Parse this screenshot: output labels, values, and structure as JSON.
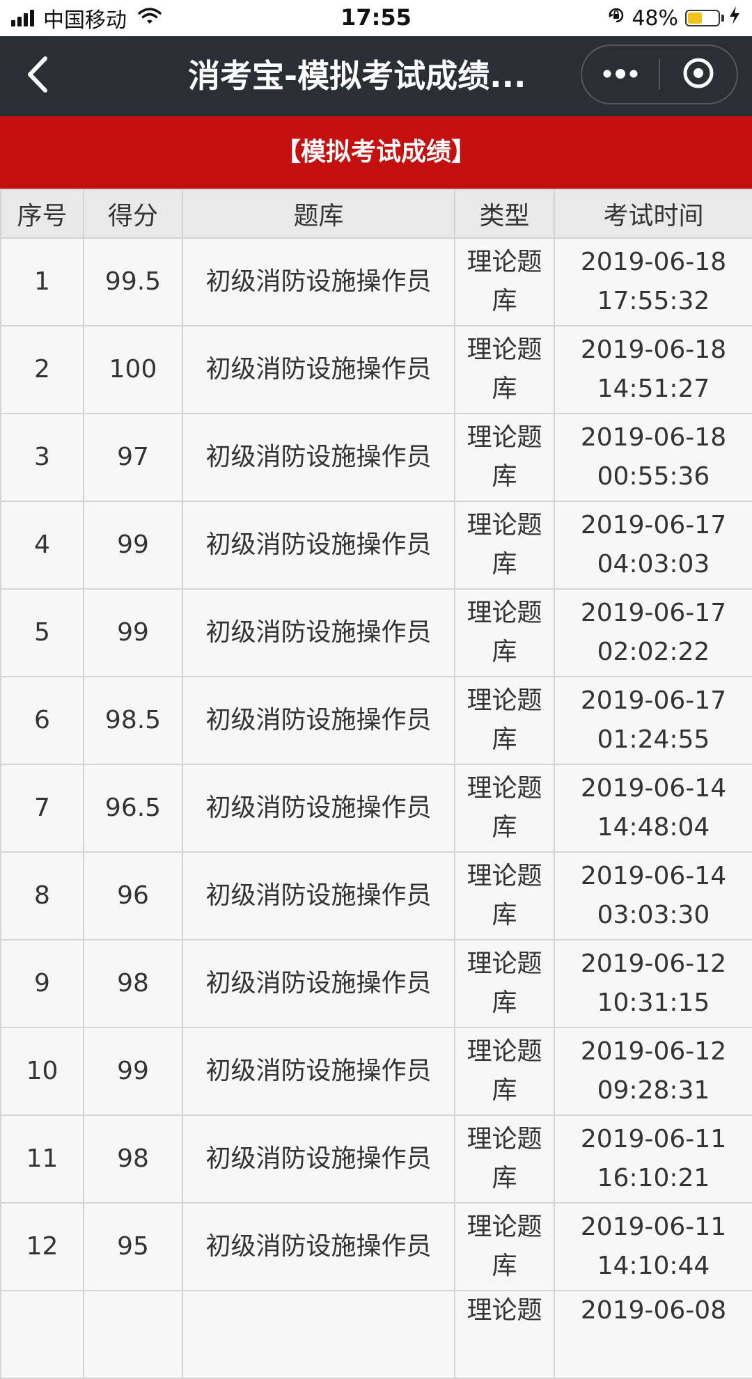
{
  "status_bar": {
    "carrier": "中国移动",
    "time": "17:55",
    "battery_percent": "48%",
    "battery_level": 0.48,
    "battery_color": "#f2c318"
  },
  "nav": {
    "title": "消考宝-模拟考试成绩...",
    "back_icon": "chevron-left-icon",
    "more_icon": "more-dots-icon",
    "close_icon": "target-circle-icon",
    "background": "#2b2f33"
  },
  "banner": {
    "text": "【模拟考试成绩】",
    "background": "#c4110f"
  },
  "table": {
    "headers": [
      "序号",
      "得分",
      "题库",
      "类型",
      "考试时间"
    ],
    "rows": [
      {
        "no": "1",
        "score": "99.5",
        "bank": "初级消防设施操作员",
        "type": "理论题库",
        "date": "2019-06-18",
        "time": "17:55:32"
      },
      {
        "no": "2",
        "score": "100",
        "bank": "初级消防设施操作员",
        "type": "理论题库",
        "date": "2019-06-18",
        "time": "14:51:27"
      },
      {
        "no": "3",
        "score": "97",
        "bank": "初级消防设施操作员",
        "type": "理论题库",
        "date": "2019-06-18",
        "time": "00:55:36"
      },
      {
        "no": "4",
        "score": "99",
        "bank": "初级消防设施操作员",
        "type": "理论题库",
        "date": "2019-06-17",
        "time": "04:03:03"
      },
      {
        "no": "5",
        "score": "99",
        "bank": "初级消防设施操作员",
        "type": "理论题库",
        "date": "2019-06-17",
        "time": "02:02:22"
      },
      {
        "no": "6",
        "score": "98.5",
        "bank": "初级消防设施操作员",
        "type": "理论题库",
        "date": "2019-06-17",
        "time": "01:24:55"
      },
      {
        "no": "7",
        "score": "96.5",
        "bank": "初级消防设施操作员",
        "type": "理论题库",
        "date": "2019-06-14",
        "time": "14:48:04"
      },
      {
        "no": "8",
        "score": "96",
        "bank": "初级消防设施操作员",
        "type": "理论题库",
        "date": "2019-06-14",
        "time": "03:03:30"
      },
      {
        "no": "9",
        "score": "98",
        "bank": "初级消防设施操作员",
        "type": "理论题库",
        "date": "2019-06-12",
        "time": "10:31:15"
      },
      {
        "no": "10",
        "score": "99",
        "bank": "初级消防设施操作员",
        "type": "理论题库",
        "date": "2019-06-12",
        "time": "09:28:31"
      },
      {
        "no": "11",
        "score": "98",
        "bank": "初级消防设施操作员",
        "type": "理论题库",
        "date": "2019-06-11",
        "time": "16:10:21"
      },
      {
        "no": "12",
        "score": "95",
        "bank": "初级消防设施操作员",
        "type": "理论题库",
        "date": "2019-06-11",
        "time": "14:10:44"
      }
    ],
    "partial_row": {
      "type": "理论题",
      "date": "2019-06-08"
    }
  }
}
